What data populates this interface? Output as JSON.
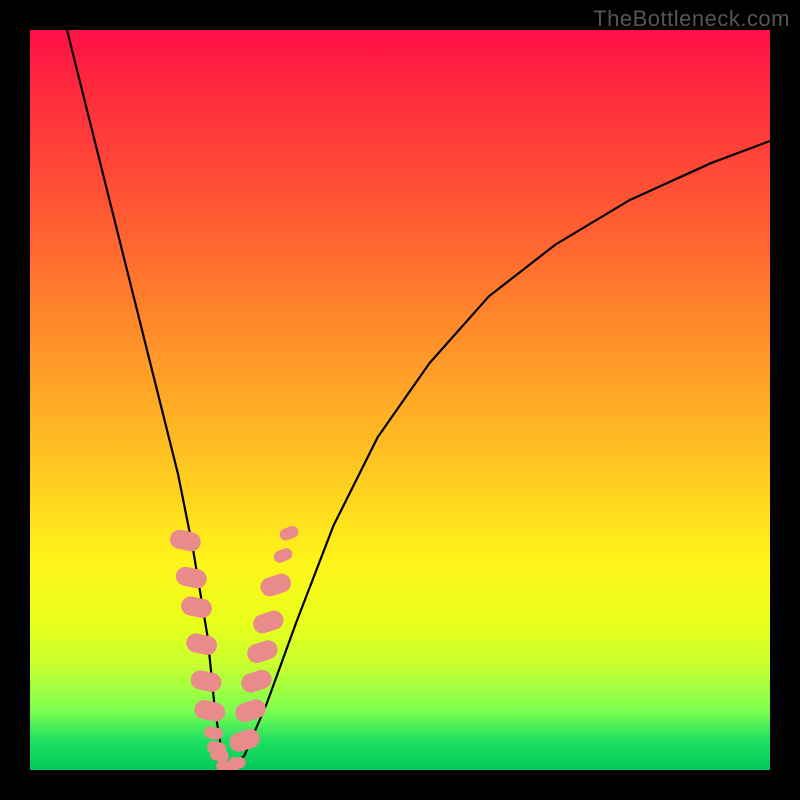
{
  "watermark": "TheBottleneck.com",
  "colors": {
    "frame": "#000000",
    "gradient_top": "#ff0f46",
    "gradient_mid1": "#ff8a2a",
    "gradient_mid2": "#fff51a",
    "gradient_bottom": "#00c95a",
    "curve": "#000000",
    "marker": "#e98b8b"
  },
  "chart_data": {
    "type": "line",
    "title": "",
    "xlabel": "",
    "ylabel": "",
    "xlim": [
      0,
      100
    ],
    "ylim": [
      0,
      100
    ],
    "grid": false,
    "legend": false,
    "series": [
      {
        "name": "bottleneck-curve",
        "x": [
          5,
          8,
          11,
          14,
          17,
          20,
          22,
          24,
          25,
          26,
          27,
          29,
          32,
          36,
          41,
          47,
          54,
          62,
          71,
          81,
          92,
          100
        ],
        "y": [
          100,
          88,
          76,
          64,
          52,
          40,
          30,
          18,
          8,
          2,
          0,
          2,
          9,
          20,
          33,
          45,
          55,
          64,
          71,
          77,
          82,
          85
        ]
      },
      {
        "name": "thick-markers-left",
        "x": [
          21.0,
          21.8,
          22.5,
          23.2,
          23.8,
          24.3
        ],
        "y": [
          31,
          26,
          22,
          17,
          12,
          8
        ]
      },
      {
        "name": "thin-markers-left",
        "x": [
          24.8,
          25.2,
          25.6
        ],
        "y": [
          5,
          3,
          2
        ]
      },
      {
        "name": "thin-markers-bottom",
        "x": [
          26.3,
          27.2,
          28.0
        ],
        "y": [
          0.5,
          0.5,
          1.0
        ]
      },
      {
        "name": "thick-markers-right",
        "x": [
          29.0,
          29.8,
          30.6,
          31.4,
          32.2,
          33.2
        ],
        "y": [
          4,
          8,
          12,
          16,
          20,
          25
        ]
      },
      {
        "name": "thin-markers-right-upper",
        "x": [
          34.2,
          35.0
        ],
        "y": [
          29,
          32
        ]
      }
    ]
  }
}
